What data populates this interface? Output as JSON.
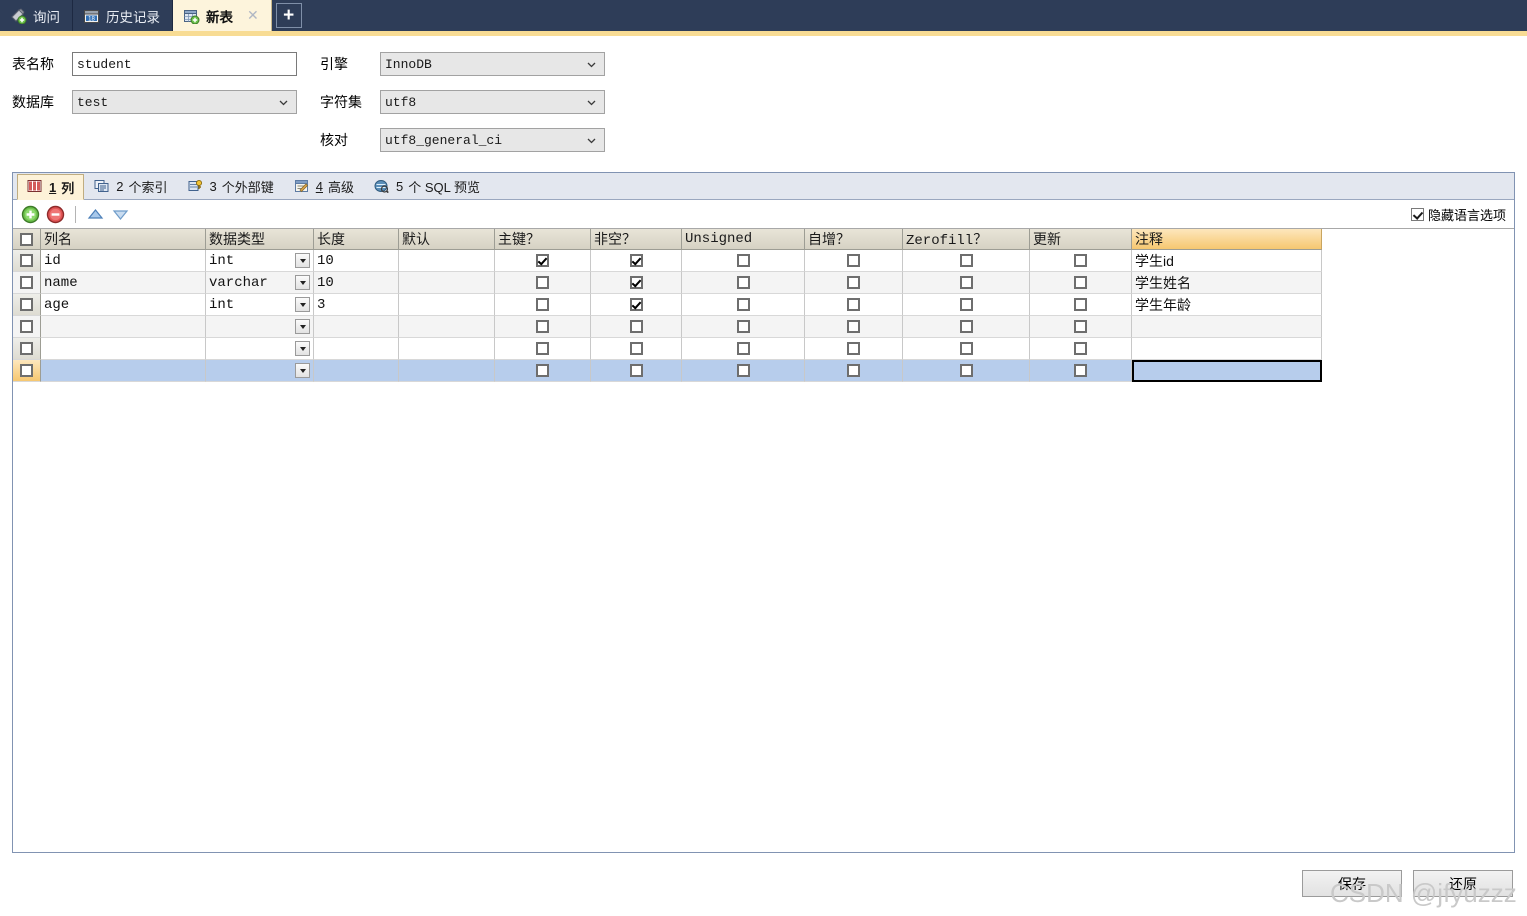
{
  "window": {
    "tabs": [
      {
        "label": "询问",
        "icon": "query-icon",
        "active": false,
        "closable": false
      },
      {
        "label": "历史记录",
        "icon": "history-calendar-icon",
        "active": false,
        "closable": false
      },
      {
        "label": "新表",
        "icon": "new-table-icon",
        "active": true,
        "closable": true,
        "close_glyph": "✕"
      }
    ],
    "new_tab_glyph": "+"
  },
  "form": {
    "table_name_label": "表名称",
    "table_name_value": "student",
    "database_label": "数据库",
    "database_value": "test",
    "engine_label": "引擎",
    "engine_value": "InnoDB",
    "charset_label": "字符集",
    "charset_value": "utf8",
    "collation_label": "核对",
    "collation_value": "utf8_general_ci"
  },
  "inner_tabs": [
    {
      "num": "1",
      "label": " 列",
      "icon": "columns-icon",
      "active": true
    },
    {
      "num": "2",
      "label": " 个索引",
      "icon": "index-icon",
      "active": false
    },
    {
      "num": "3",
      "label": " 个外部键",
      "icon": "foreign-key-icon",
      "active": false
    },
    {
      "num": "4",
      "label": "高级",
      "icon": "advanced-icon",
      "active": false
    },
    {
      "num": "5",
      "label": " 个 SQL 预览",
      "icon": "sql-preview-icon",
      "active": false
    }
  ],
  "toolbar": {
    "add_title": "添加栏位",
    "remove_title": "删除栏位",
    "up_title": "上移",
    "down_title": "下移",
    "hide_lang_label": "隐藏语言选项",
    "hide_lang_checked": true
  },
  "grid": {
    "headers": [
      "列名",
      "数据类型",
      "长度",
      "默认",
      "主键？",
      "非空？",
      "Unsigned",
      "自增？",
      "Zerofill？",
      "更新",
      "注释"
    ],
    "rows": [
      {
        "name": "id",
        "type": "int",
        "length": "10",
        "default": "",
        "pk": true,
        "notnull": true,
        "unsigned": false,
        "autoinc": false,
        "zerofill": false,
        "update": false,
        "comment": "学生id",
        "selected": false
      },
      {
        "name": "name",
        "type": "varchar",
        "length": "10",
        "default": "",
        "pk": false,
        "notnull": true,
        "unsigned": false,
        "autoinc": false,
        "zerofill": false,
        "update": false,
        "comment": "学生姓名",
        "selected": false
      },
      {
        "name": "age",
        "type": "int",
        "length": "3",
        "default": "",
        "pk": false,
        "notnull": true,
        "unsigned": false,
        "autoinc": false,
        "zerofill": false,
        "update": false,
        "comment": "学生年龄",
        "selected": false
      },
      {
        "name": "",
        "type": "",
        "length": "",
        "default": "",
        "pk": false,
        "notnull": false,
        "unsigned": false,
        "autoinc": false,
        "zerofill": false,
        "update": false,
        "comment": "",
        "selected": false
      },
      {
        "name": "",
        "type": "",
        "length": "",
        "default": "",
        "pk": false,
        "notnull": false,
        "unsigned": false,
        "autoinc": false,
        "zerofill": false,
        "update": false,
        "comment": "",
        "selected": false
      },
      {
        "name": "",
        "type": "",
        "length": "",
        "default": "",
        "pk": false,
        "notnull": false,
        "unsigned": false,
        "autoinc": false,
        "zerofill": false,
        "update": false,
        "comment": "",
        "selected": true
      }
    ],
    "focused_cell": {
      "row": 5,
      "column": "注释"
    }
  },
  "footer": {
    "save_label": "保存",
    "restore_label": "还原"
  },
  "watermark": "CSDN @jfyuzzz",
  "colors": {
    "topbar_bg": "#2e3d58",
    "topbar_strip": "#f8dc94",
    "active_tab_bg": "#fdf4dc",
    "comment_header": "#f6c770",
    "selected_row": "#b7cdec",
    "panel_border": "#8193b2"
  }
}
